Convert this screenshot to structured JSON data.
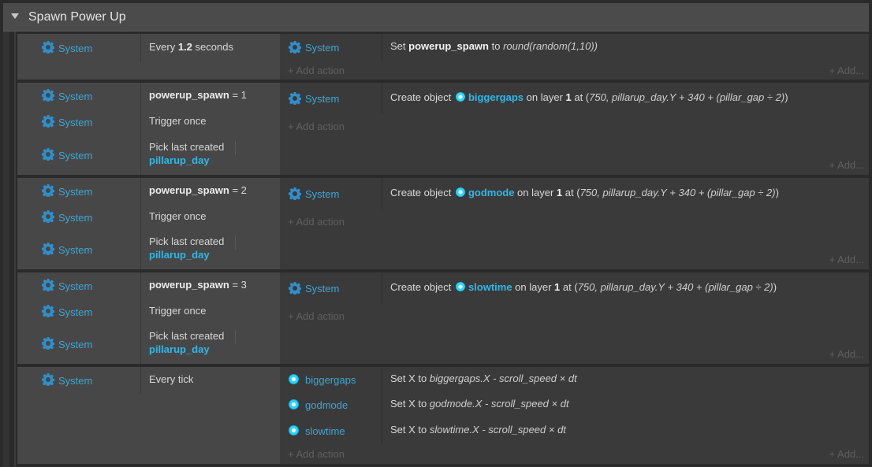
{
  "group": {
    "title": "Spawn Power Up"
  },
  "labels": {
    "system": "System",
    "add_action": "+ Add action",
    "add_more": "+ Add..."
  },
  "events": [
    {
      "conditions": [
        {
          "object": "System",
          "parts": [
            [
              "t",
              "Every "
            ],
            [
              "b",
              "1.2"
            ],
            [
              "t",
              " seconds"
            ]
          ]
        }
      ],
      "actions": [
        {
          "object": "System",
          "parts": [
            [
              "t",
              "Set "
            ],
            [
              "b",
              "powerup_spawn"
            ],
            [
              "t",
              " to "
            ],
            [
              "i",
              "round(random(1,10))"
            ]
          ]
        }
      ]
    },
    {
      "conditions": [
        {
          "object": "System",
          "parts": [
            [
              "b",
              "powerup_spawn"
            ],
            [
              "t",
              " = 1"
            ]
          ]
        },
        {
          "object": "System",
          "parts": [
            [
              "t",
              "Trigger once"
            ]
          ]
        },
        {
          "object": "System",
          "line1": "Pick last created",
          "line2": "pillarup_day"
        }
      ],
      "actions": [
        {
          "object": "System",
          "parts": [
            [
              "t",
              "Create object "
            ],
            [
              "dot",
              ""
            ],
            [
              "o",
              "biggergaps"
            ],
            [
              "t",
              " on layer "
            ],
            [
              "b",
              "1"
            ],
            [
              "t",
              " at ("
            ],
            [
              "i",
              "750, pillarup_day.Y + 340 + (pillar_gap ÷ 2)"
            ],
            [
              "t",
              ")"
            ]
          ]
        }
      ]
    },
    {
      "conditions": [
        {
          "object": "System",
          "parts": [
            [
              "b",
              "powerup_spawn"
            ],
            [
              "t",
              " = 2"
            ]
          ]
        },
        {
          "object": "System",
          "parts": [
            [
              "t",
              "Trigger once"
            ]
          ]
        },
        {
          "object": "System",
          "line1": "Pick last created",
          "line2": "pillarup_day"
        }
      ],
      "actions": [
        {
          "object": "System",
          "parts": [
            [
              "t",
              "Create object "
            ],
            [
              "dot",
              ""
            ],
            [
              "o",
              "godmode"
            ],
            [
              "t",
              " on layer "
            ],
            [
              "b",
              "1"
            ],
            [
              "t",
              " at ("
            ],
            [
              "i",
              "750, pillarup_day.Y + 340 + (pillar_gap ÷ 2)"
            ],
            [
              "t",
              ")"
            ]
          ]
        }
      ]
    },
    {
      "conditions": [
        {
          "object": "System",
          "parts": [
            [
              "b",
              "powerup_spawn"
            ],
            [
              "t",
              " = 3"
            ]
          ]
        },
        {
          "object": "System",
          "parts": [
            [
              "t",
              "Trigger once"
            ]
          ]
        },
        {
          "object": "System",
          "line1": "Pick last created",
          "line2": "pillarup_day"
        }
      ],
      "actions": [
        {
          "object": "System",
          "parts": [
            [
              "t",
              "Create object "
            ],
            [
              "dot",
              ""
            ],
            [
              "o",
              "slowtime"
            ],
            [
              "t",
              " on layer "
            ],
            [
              "b",
              "1"
            ],
            [
              "t",
              " at ("
            ],
            [
              "i",
              "750, pillarup_day.Y + 340 + (pillar_gap ÷ 2)"
            ],
            [
              "t",
              ")"
            ]
          ]
        }
      ]
    },
    {
      "conditions": [
        {
          "object": "System",
          "parts": [
            [
              "t",
              "Every tick"
            ]
          ]
        }
      ],
      "actions": [
        {
          "object": "biggergaps",
          "icon": "sprite-dot-icon",
          "parts": [
            [
              "t",
              "Set X to "
            ],
            [
              "i",
              "biggergaps.X - scroll_speed × dt"
            ]
          ]
        },
        {
          "object": "godmode",
          "icon": "sprite-dot-icon",
          "parts": [
            [
              "t",
              "Set X to "
            ],
            [
              "i",
              "godmode.X - scroll_speed × dt"
            ]
          ]
        },
        {
          "object": "slowtime",
          "icon": "sprite-dot-icon",
          "parts": [
            [
              "t",
              "Set X to "
            ],
            [
              "i",
              "slowtime.X - scroll_speed × dt"
            ]
          ]
        }
      ]
    }
  ],
  "colors": {
    "link": "#3ba7d6",
    "object": "#2fb8e8",
    "gear": "#2f8fcb"
  }
}
